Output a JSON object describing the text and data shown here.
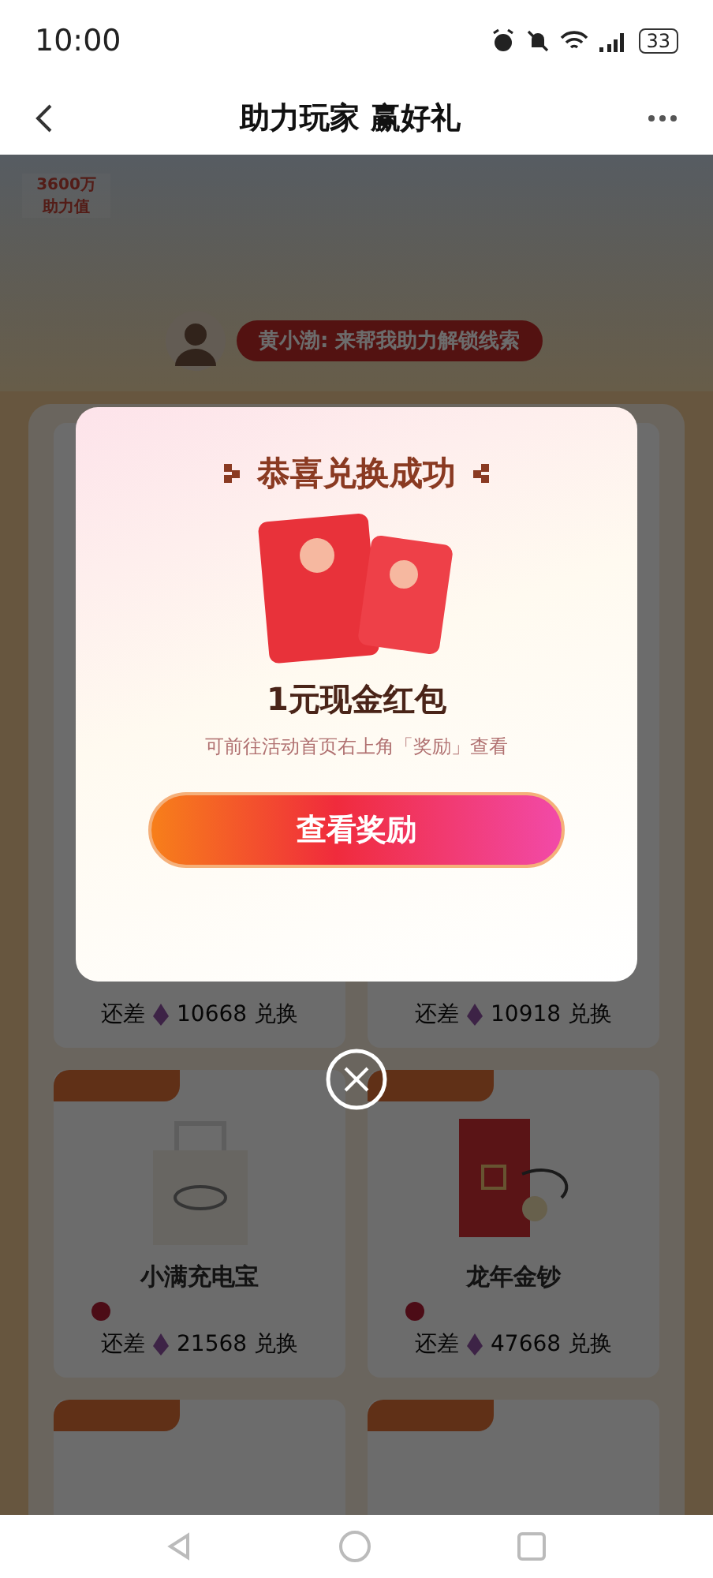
{
  "status_bar": {
    "time": "10:00",
    "battery": "33"
  },
  "header": {
    "title": "助力玩家 赢好礼"
  },
  "hero": {
    "badge_value": "3600万",
    "badge_label": "助力值",
    "speech": "黄小渤: 来帮我助力解锁线索"
  },
  "rewards": [
    {
      "prefix": "还差",
      "amount": "10668",
      "action": "兑换"
    },
    {
      "prefix": "还差",
      "amount": "10918",
      "action": "兑换"
    },
    {
      "name": "小满充电宝",
      "prefix": "还差",
      "amount": "21568",
      "action": "兑换",
      "kind": "bag"
    },
    {
      "name": "龙年金钞",
      "prefix": "还差",
      "amount": "47668",
      "action": "兑换",
      "kind": "note"
    }
  ],
  "dialog": {
    "title": "恭喜兑换成功",
    "prize": "1元现金红包",
    "hint": "可前往活动首页右上角「奖励」查看",
    "button": "查看奖励"
  }
}
